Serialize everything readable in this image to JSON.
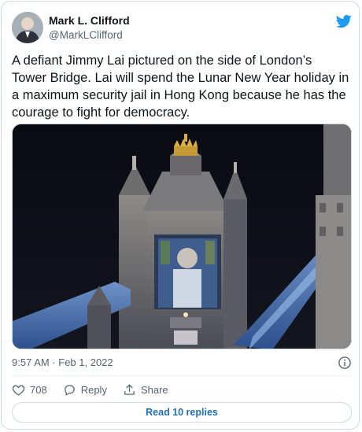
{
  "tweet": {
    "author_name": "Mark L. Clifford",
    "author_handle": "@MarkLClifford",
    "text": "A defiant Jimmy Lai pictured on the side of London’s\nTower Bridge. Lai will spend the Lunar New Year holiday in\na maximum security jail in Hong Kong because he has the\ncourage to fight for democracy.",
    "timestamp": "9:57 AM · Feb 1, 2022",
    "like_count": "708",
    "reply_label": "Reply",
    "share_label": "Share",
    "read_replies_label": "Read 10 replies"
  },
  "icons": {
    "brand": "twitter-bird-icon",
    "info": "info-icon",
    "like": "heart-icon",
    "reply": "reply-icon",
    "share": "share-icon"
  },
  "colors": {
    "twitter_blue": "#1d9bf0",
    "secondary_text": "#536471",
    "link_blue": "#1d6fbf"
  }
}
